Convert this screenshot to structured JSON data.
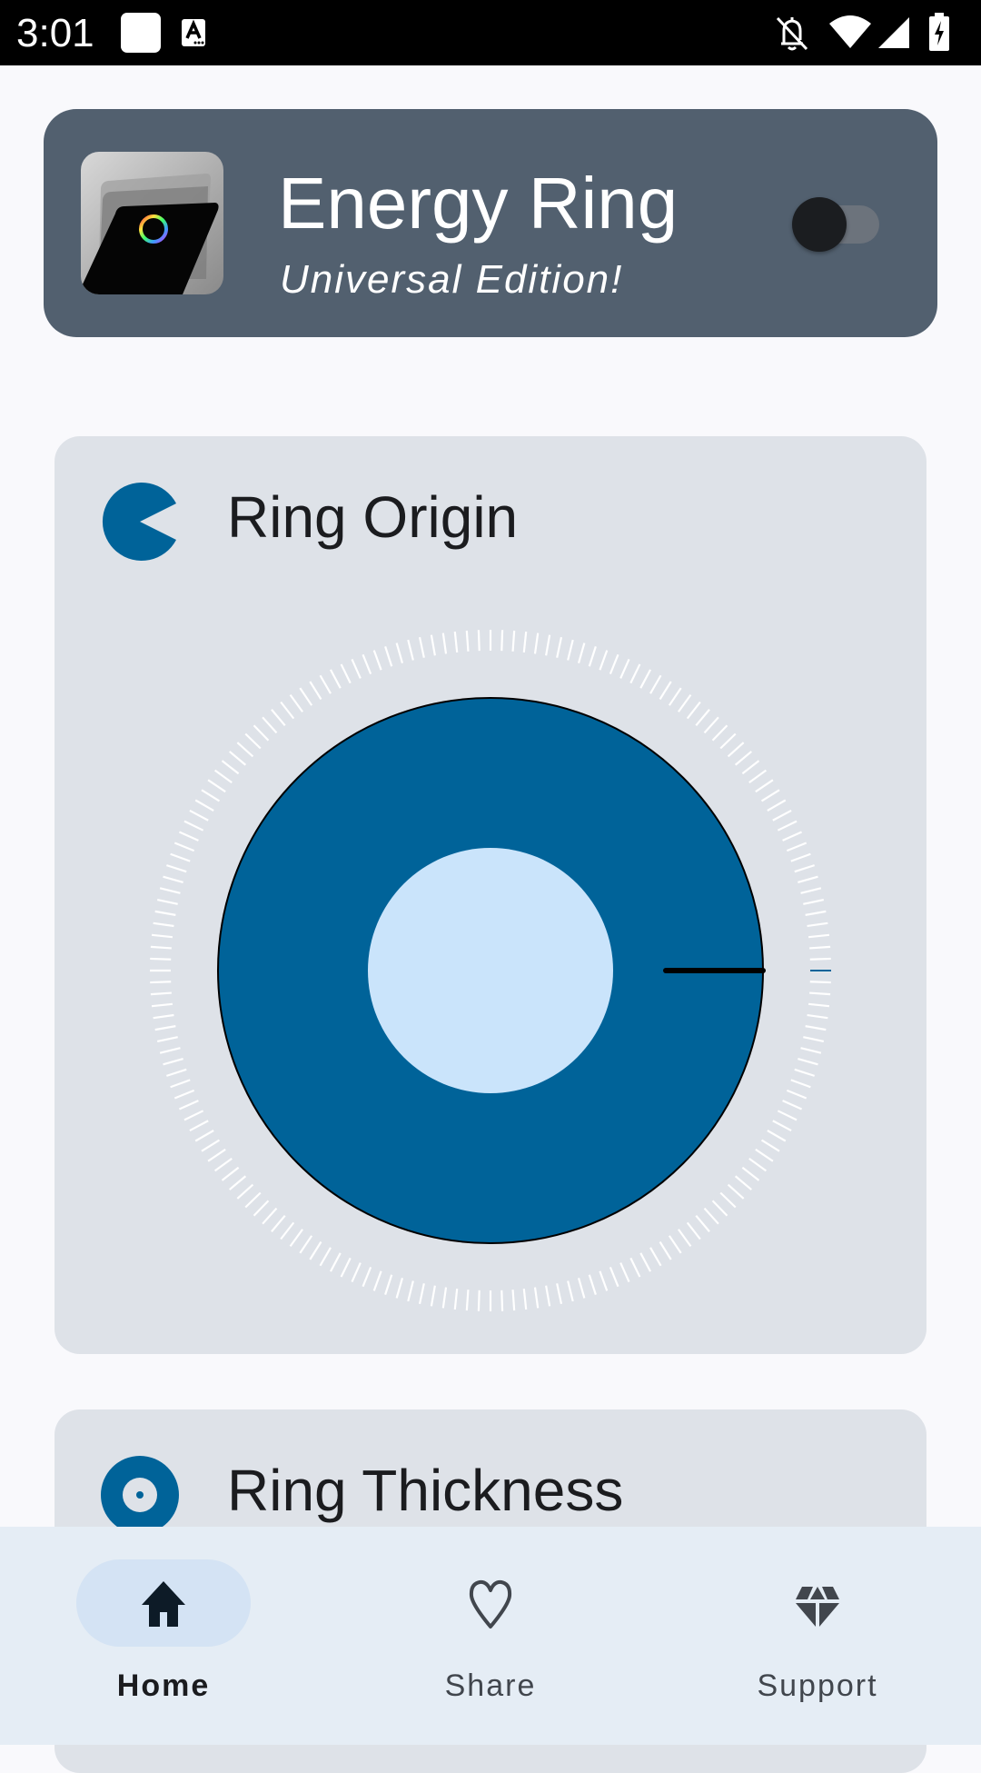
{
  "status_bar": {
    "time": "3:01",
    "left_icons": [
      "notification-square-icon",
      "keyboard-a-icon"
    ],
    "right_icons": [
      "bell-off-icon",
      "wifi-icon",
      "cell-signal-icon",
      "battery-charging-icon"
    ]
  },
  "header": {
    "title": "Energy Ring",
    "subtitle": "Universal Edition!",
    "app_icon": "energy-ring-app-icon",
    "toggle_on": false
  },
  "cards": [
    {
      "title": "Ring Origin",
      "icon": "pie-origin-icon",
      "dial": {
        "origin_angle_deg": 0,
        "tick_count": 180,
        "colors": {
          "ring": "#006399",
          "inner": "#cae4fb",
          "ticks": "#ffffff",
          "marker": "#006399",
          "needle": "#000000"
        }
      }
    },
    {
      "title": "Ring Thickness",
      "icon": "ring-thickness-icon"
    }
  ],
  "bottom_nav": {
    "items": [
      {
        "label": "Home",
        "icon": "home-icon",
        "active": true
      },
      {
        "label": "Share",
        "icon": "heart-icon",
        "active": false
      },
      {
        "label": "Support",
        "icon": "diamond-icon",
        "active": false
      }
    ]
  },
  "colors": {
    "accent": "#006399",
    "header_bg": "#52606f",
    "card_bg": "#dee2e8",
    "nav_bg": "#e5edf5",
    "nav_active_pill": "#d4e3f4",
    "page_bg": "#f9f9fc"
  }
}
